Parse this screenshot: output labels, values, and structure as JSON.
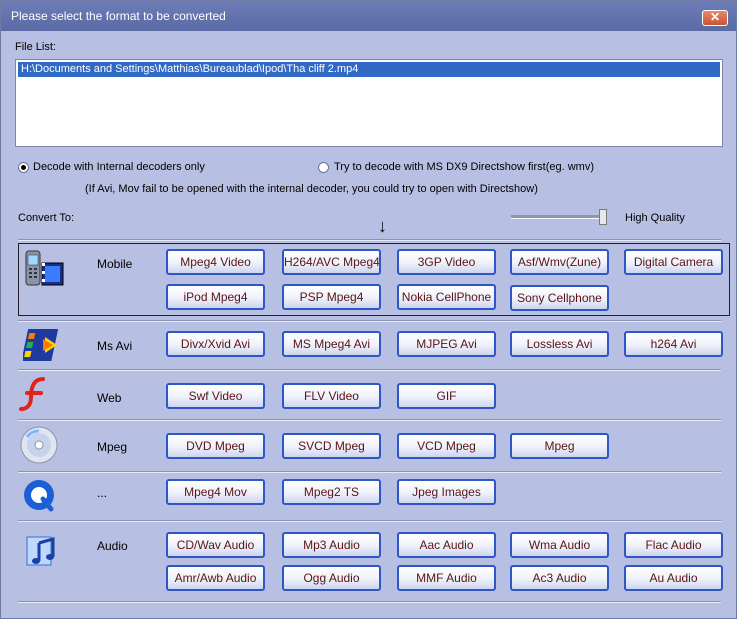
{
  "window": {
    "title": "Please select the format to be converted",
    "close_label": "✕"
  },
  "file_list": {
    "label": "File List:",
    "items": [
      "H:\\Documents and Settings\\Matthias\\Bureaublad\\Ipod\\Tha cliff 2.mp4"
    ]
  },
  "decode": {
    "internal_label": "Decode with Internal decoders only",
    "directshow_label": "Try to decode with MS DX9 Directshow first(eg. wmv)",
    "note": "(If Avi, Mov fail to be opened with the internal decoder, you could try to open with Directshow)"
  },
  "convert": {
    "label": "Convert To:",
    "quality_label": "High Quality",
    "quality_level": 1.0
  },
  "categories": [
    {
      "label": "Mobile",
      "icon": "mobile-phone-icon",
      "buttons": [
        "Mpeg4 Video",
        "H264/AVC Mpeg4",
        "3GP Video",
        "Asf/Wmv(Zune)",
        "Digital Camera",
        "iPod Mpeg4",
        "PSP Mpeg4",
        "Nokia CellPhone",
        "Sony Cellphone"
      ]
    },
    {
      "label": "Ms Avi",
      "icon": "windows-media-icon",
      "buttons": [
        "Divx/Xvid Avi",
        "MS Mpeg4 Avi",
        "MJPEG Avi",
        "Lossless Avi",
        "h264 Avi"
      ]
    },
    {
      "label": "Web",
      "icon": "flash-icon",
      "buttons": [
        "Swf Video",
        "FLV Video",
        "GIF"
      ]
    },
    {
      "label": "Mpeg",
      "icon": "disc-icon",
      "buttons": [
        "DVD Mpeg",
        "SVCD Mpeg",
        "VCD Mpeg",
        "Mpeg"
      ]
    },
    {
      "label": "...",
      "icon": "quicktime-icon",
      "buttons": [
        "Mpeg4 Mov",
        "Mpeg2 TS",
        "Jpeg Images"
      ]
    },
    {
      "label": "Audio",
      "icon": "music-note-icon",
      "buttons": [
        "CD/Wav Audio",
        "Mp3 Audio",
        "Aac Audio",
        "Wma Audio",
        "Flac Audio",
        "Amr/Awb Audio",
        "Ogg  Audio",
        "MMF Audio",
        "Ac3 Audio",
        "Au  Audio"
      ]
    }
  ]
}
